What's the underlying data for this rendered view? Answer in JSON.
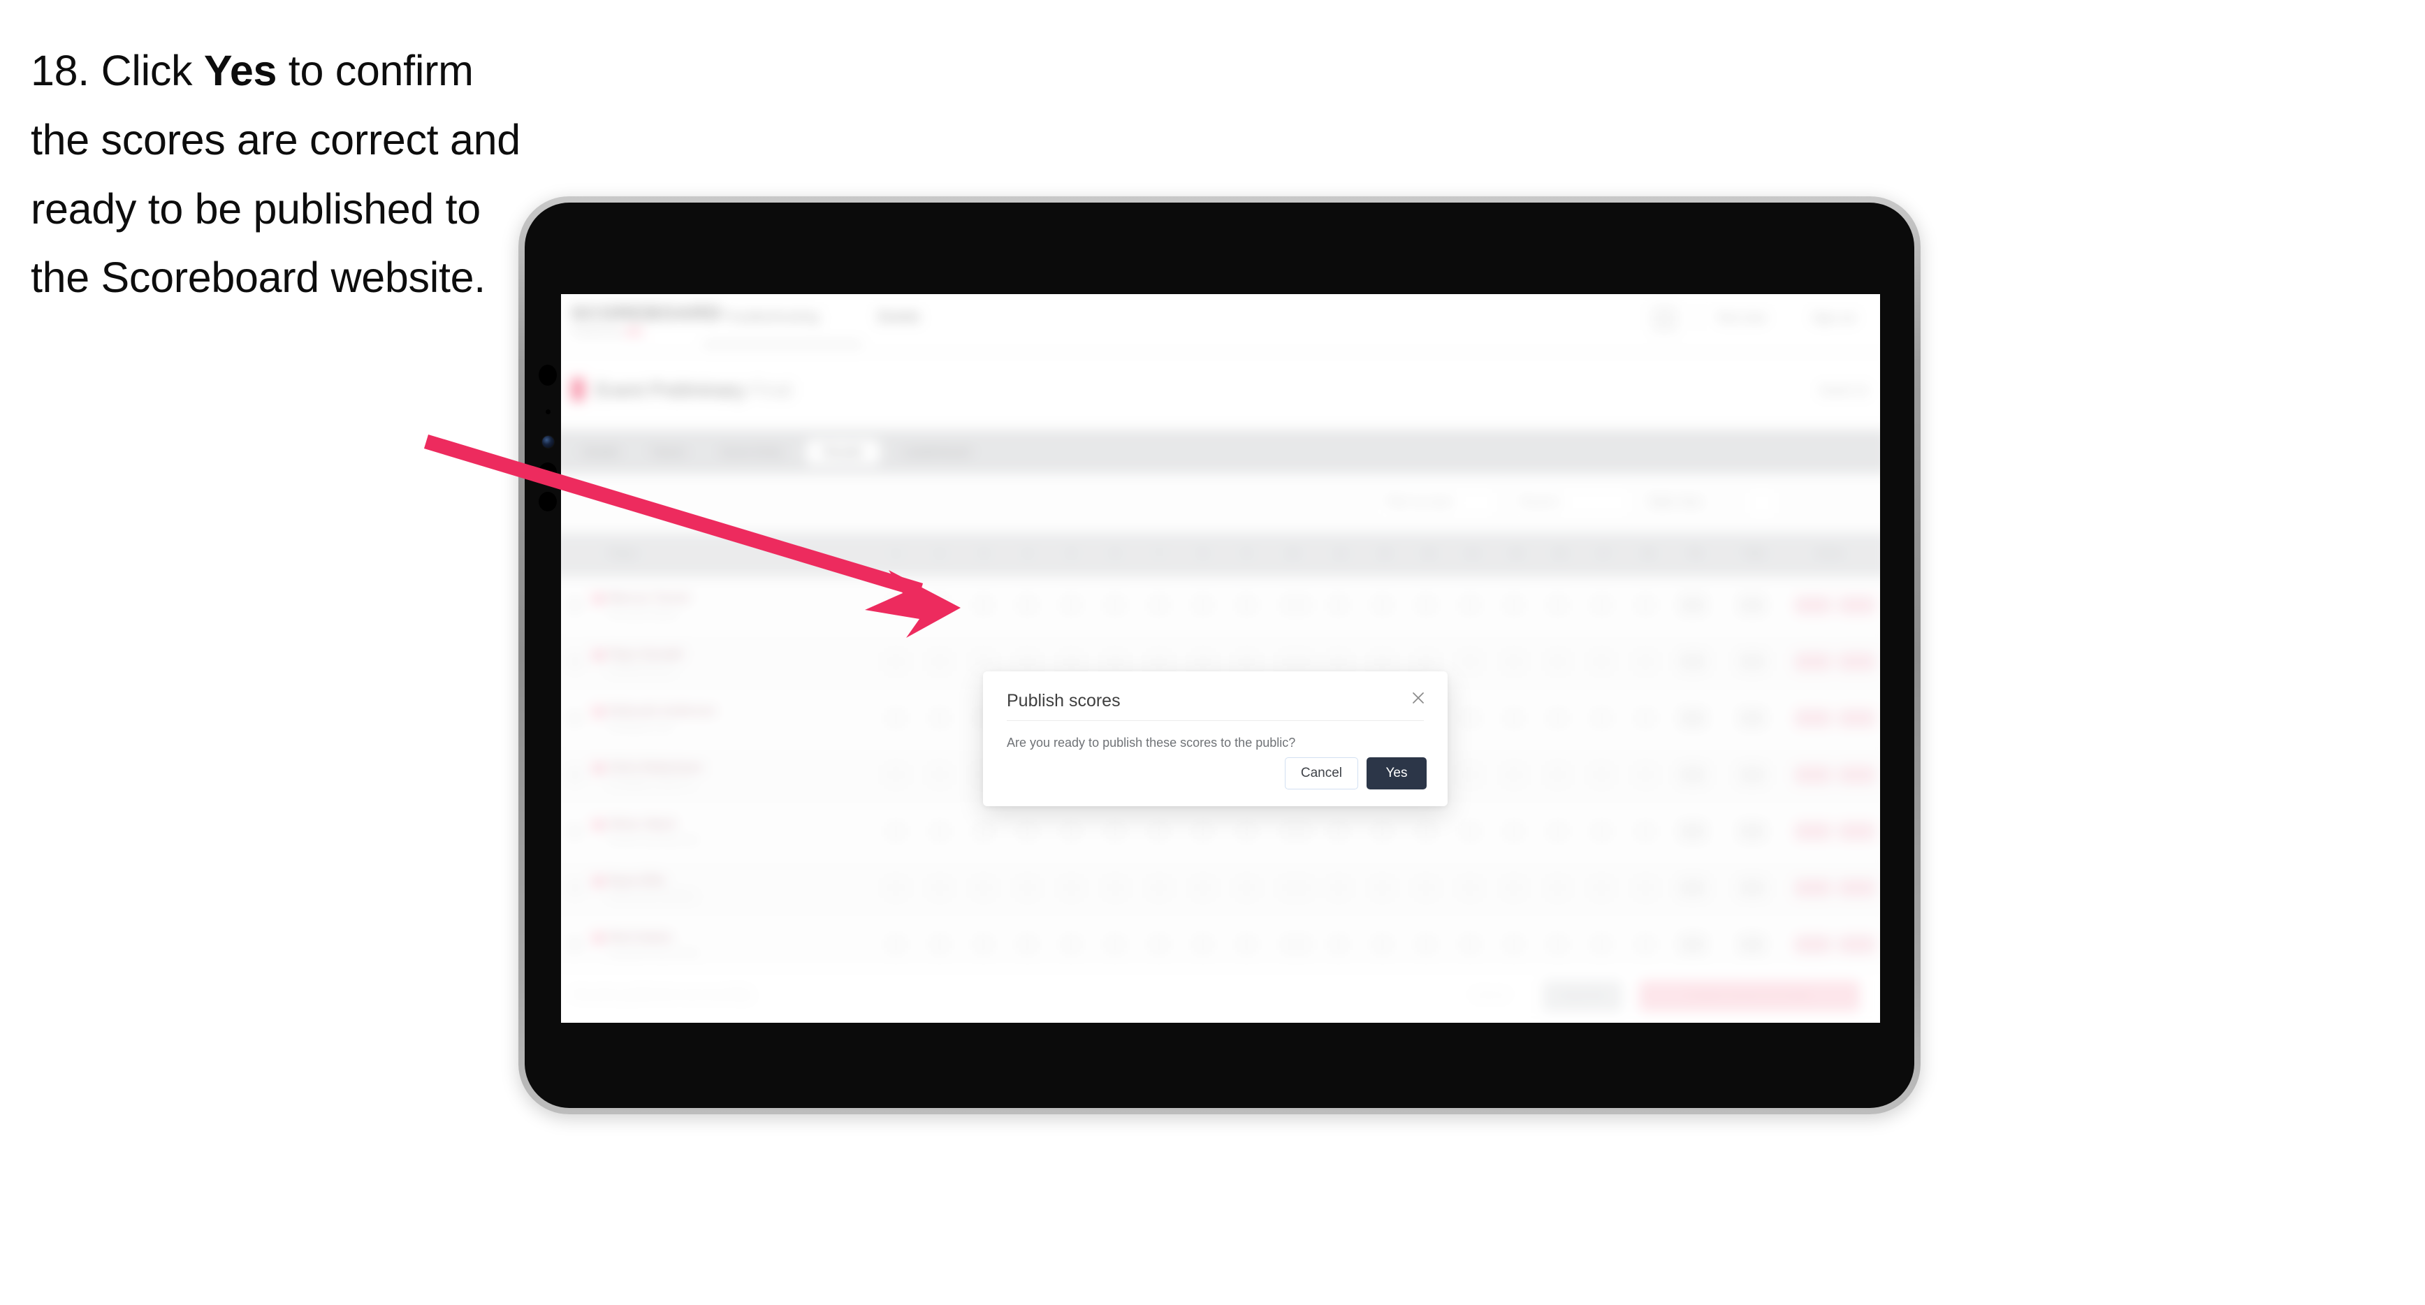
{
  "instruction": {
    "number": "18.",
    "lead": "Click ",
    "emphasis": "Yes",
    "rest": " to confirm the scores are correct and ready to be published to the Scoreboard website."
  },
  "annotation": {
    "arrow_color": "#ED2B5E",
    "points_to": "yes-button"
  },
  "device": {
    "type": "tablet",
    "orientation": "landscape",
    "bezel_color": "#0b0b0b",
    "frame_color": "#9e9e9e"
  },
  "app": {
    "header": {
      "logo": "SCOREBOARD",
      "tagline": "Powered by",
      "tagline_accent": "AFL",
      "nav": [
        {
          "label": "Troubleshooting",
          "active": false
        },
        {
          "label": "Events",
          "active": false
        }
      ],
      "right": [
        {
          "label": "Test User"
        },
        {
          "label": "Sign out"
        }
      ],
      "avatar": "user-avatar"
    },
    "event_bar": {
      "flag": "event-flag",
      "title": "Event Preliminary",
      "title_muted": "Final",
      "right_label": "Event 12"
    },
    "tabs": [
      {
        "label": "Details",
        "selected": false
      },
      {
        "label": "Teams",
        "selected": false
      },
      {
        "label": "Score Entry",
        "selected": false
      },
      {
        "label": "Results",
        "selected": true
      },
      {
        "label": "Leaderboard",
        "selected": false
      }
    ],
    "filter_bar": {
      "search_placeholder": "Search",
      "controls": [
        {
          "label": "Filter by team"
        },
        {
          "label": "Round 1"
        },
        {
          "label": "Table View"
        },
        {
          "label": "grid-icon"
        }
      ]
    },
    "table": {
      "columns": [
        "Player",
        "1",
        "2",
        "3",
        "4",
        "5",
        "6",
        "7",
        "8",
        "9",
        "10",
        "11",
        "12",
        "13",
        "14",
        "15",
        "16",
        "17",
        "18",
        "Tot",
        "Total",
        "Score"
      ],
      "rows": [
        {
          "handle": "drag-handle",
          "flag": "team-flag",
          "name": "Marcus Turner",
          "club": "Riverside Athletic"
        },
        {
          "handle": "drag-handle",
          "flag": "team-flag",
          "name": "Piper Donald",
          "club": "Eastfield Rovers"
        },
        {
          "handle": "drag-handle",
          "flag": "team-flag",
          "name": "Deborah Anderson",
          "club": "Northbank Club"
        },
        {
          "handle": "drag-handle",
          "flag": "team-flag",
          "name": "Chris Robertson",
          "club": "Southgate United FC"
        },
        {
          "handle": "drag-handle",
          "flag": "team-flag",
          "name": "Oliver Ward",
          "club": "Westhill Sporting Club"
        },
        {
          "handle": "drag-handle",
          "flag": "team-flag",
          "name": "Ryan Ellis",
          "club": "Harbourview Athletics"
        },
        {
          "handle": "drag-handle",
          "flag": "team-flag",
          "name": "Nick Dukes",
          "club": "Lakeside Rovers Club"
        }
      ]
    },
    "footer": {
      "note": "Results published successfully",
      "link_label": "Cancel",
      "secondary_button": "Save All",
      "primary_button": "Publish Scores To Public"
    }
  },
  "modal": {
    "title": "Publish scores",
    "close_icon": "close-icon",
    "message": "Are you ready to publish these scores to the public?",
    "cancel_label": "Cancel",
    "confirm_label": "Yes",
    "confirm_color": "#2C3648"
  }
}
